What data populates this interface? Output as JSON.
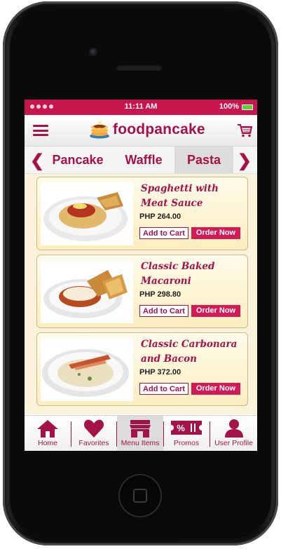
{
  "status_bar": {
    "time": "11:11 AM",
    "battery": "100%"
  },
  "app": {
    "brand": "foodpancake"
  },
  "categories": {
    "tabs": [
      {
        "label": "Pancake"
      },
      {
        "label": "Waffle"
      },
      {
        "label": "Pasta"
      }
    ],
    "active": "Pasta"
  },
  "menu": {
    "items": [
      {
        "name": "Spaghetti with Meat Sauce",
        "price": "PHP 264.00",
        "add_label": "Add to Cart",
        "order_label": "Order Now"
      },
      {
        "name": "Classic Baked Macaroni",
        "price": "PHP 298.80",
        "add_label": "Add to Cart",
        "order_label": "Order Now"
      },
      {
        "name": "Classic Carbonara and Bacon",
        "price": "PHP 372.00",
        "add_label": "Add to Cart",
        "order_label": "Order Now"
      }
    ]
  },
  "tabbar": {
    "items": [
      {
        "label": "Home",
        "icon": "home-icon"
      },
      {
        "label": "Favorites",
        "icon": "heart-icon"
      },
      {
        "label": "Menu Items",
        "icon": "store-icon"
      },
      {
        "label": "Promos",
        "icon": "ticket-icon"
      },
      {
        "label": "User Profile",
        "icon": "user-icon"
      }
    ],
    "active": "Menu Items"
  },
  "colors": {
    "accent": "#a51247",
    "status_bar": "#c8154e",
    "order_button": "#d41a56",
    "content_bg": "#fbf3d9"
  }
}
